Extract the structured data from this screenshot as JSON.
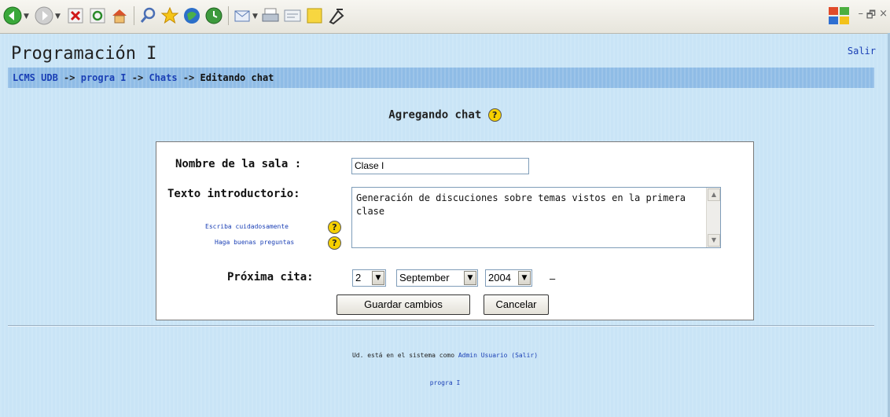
{
  "toolbar": {
    "icons": [
      "back-icon",
      "forward-icon",
      "stop-icon",
      "refresh-icon",
      "home-icon",
      "search-icon",
      "favorites-icon",
      "media-icon",
      "history-icon",
      "mail-icon",
      "print-icon",
      "edit-icon",
      "messenger-icon",
      "tool-icon"
    ]
  },
  "header": {
    "site_title": "Programación I",
    "logout_label": "Salir"
  },
  "breadcrumb": {
    "items": [
      "LCMS UDB",
      "progra I",
      "Chats"
    ],
    "separator": "->",
    "current": "Editando chat"
  },
  "form": {
    "heading": "Agregando chat",
    "help_glyph": "?",
    "room_name_label": "Nombre de la sala :",
    "room_name_value": "Clase I",
    "intro_label": "Texto introductorio:",
    "intro_value": "Generación de discuciones sobre temas vistos en la primera clase",
    "write_carefully_link": "Escriba cuidadosamente",
    "good_questions_link": "Haga buenas preguntas",
    "next_date_label": "Próxima cita:",
    "day_value": "2",
    "month_value": "September",
    "year_value": "2004",
    "dash": "–",
    "save_button": "Guardar cambios",
    "cancel_button": "Cancelar"
  },
  "footer": {
    "logged_in_prefix": "Ud. está en el sistema como",
    "user_name": "Admin Usuario",
    "logout_link": "(Salir)",
    "course_link": "progra I"
  },
  "colors": {
    "page_bg": "#c9e4f6",
    "navbar_bg": "#8fbce6",
    "link": "#1a3fb5",
    "help_icon": "#f6d000"
  }
}
